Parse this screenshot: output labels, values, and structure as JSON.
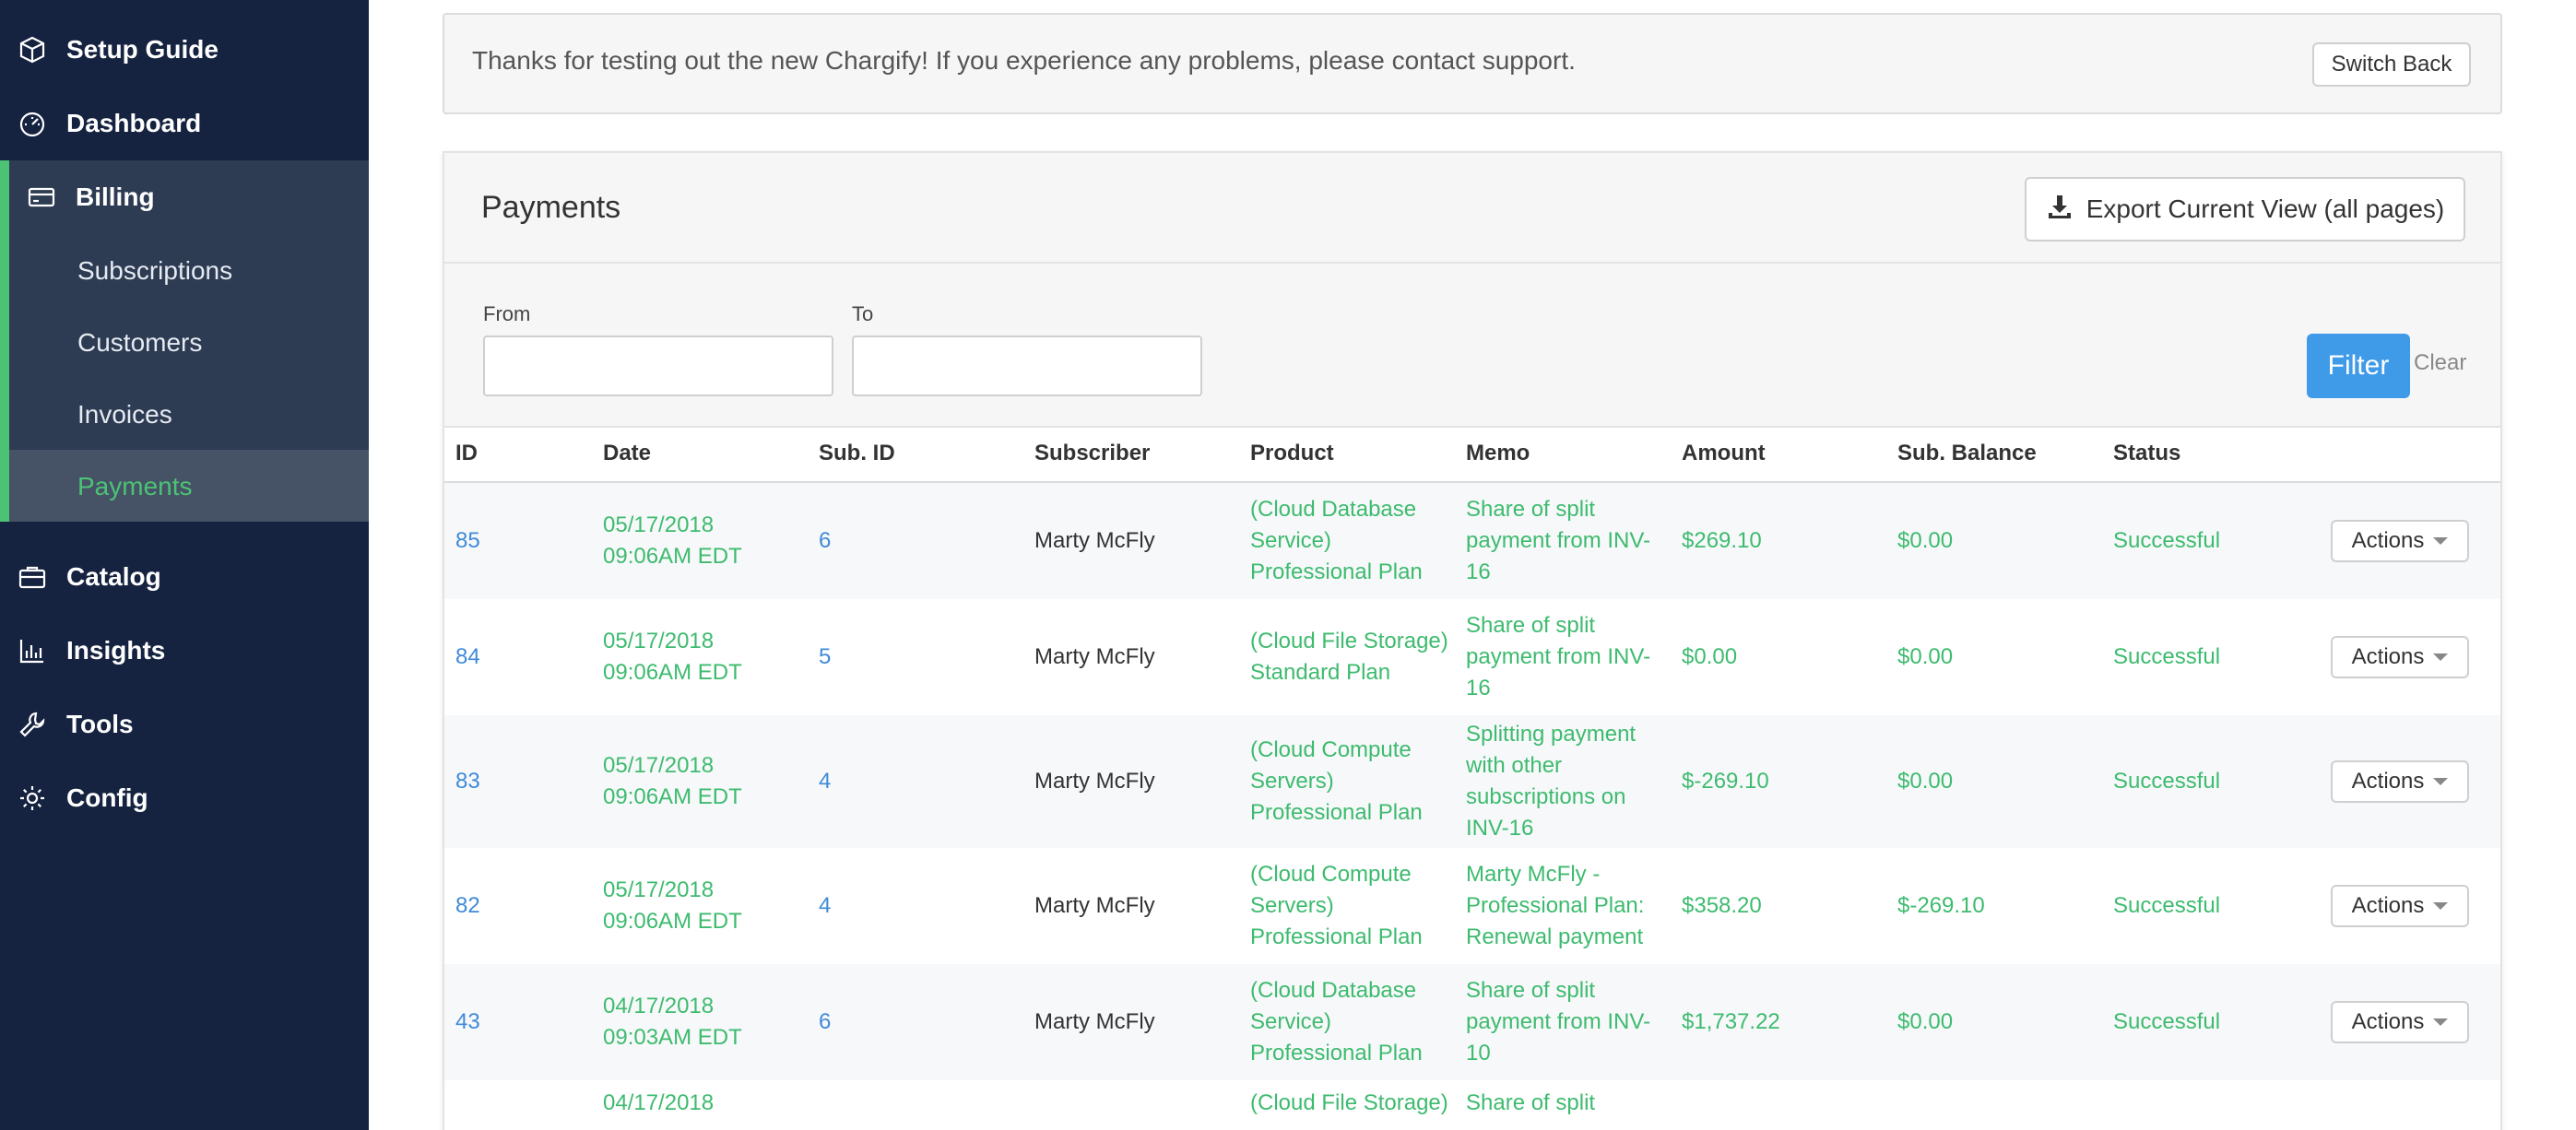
{
  "sidebar": {
    "items": [
      {
        "label": "Setup Guide",
        "icon": "cube-icon"
      },
      {
        "label": "Dashboard",
        "icon": "gauge-icon"
      },
      {
        "label": "Billing",
        "icon": "credit-card-icon"
      },
      {
        "label": "Catalog",
        "icon": "briefcase-icon"
      },
      {
        "label": "Insights",
        "icon": "bar-chart-icon"
      },
      {
        "label": "Tools",
        "icon": "wrench-icon"
      },
      {
        "label": "Config",
        "icon": "gear-icon"
      }
    ],
    "billing_sub": [
      "Subscriptions",
      "Customers",
      "Invoices",
      "Payments"
    ],
    "active_sub": "Payments"
  },
  "notice": {
    "text": "Thanks for testing out the new Chargify! If you experience any problems, please contact support.",
    "button": "Switch Back"
  },
  "panel": {
    "title": "Payments",
    "export_label": "Export Current View (all pages)"
  },
  "filter": {
    "from_label": "From",
    "to_label": "To",
    "from_value": "",
    "to_value": "",
    "filter_label": "Filter",
    "clear_label": "Clear"
  },
  "table": {
    "headers": [
      "ID",
      "Date",
      "Sub. ID",
      "Subscriber",
      "Product",
      "Memo",
      "Amount",
      "Sub. Balance",
      "Status"
    ],
    "rows": [
      {
        "id": "85",
        "date": "05/17/2018\n09:06AM EDT",
        "sub_id": "6",
        "subscriber": "Marty McFly",
        "product": "(Cloud Database\nService)\nProfessional Plan",
        "memo": "Share of split\npayment from INV-\n16",
        "amount": "$269.10",
        "balance": "$0.00",
        "status": "Successful",
        "action": "Actions"
      },
      {
        "id": "84",
        "date": "05/17/2018\n09:06AM EDT",
        "sub_id": "5",
        "subscriber": "Marty McFly",
        "product": "(Cloud File Storage)\nStandard Plan",
        "memo": "Share of split\npayment from INV-\n16",
        "amount": "$0.00",
        "balance": "$0.00",
        "status": "Successful",
        "action": "Actions"
      },
      {
        "id": "83",
        "date": "05/17/2018\n09:06AM EDT",
        "sub_id": "4",
        "subscriber": "Marty McFly",
        "product": "(Cloud Compute\nServers)\nProfessional Plan",
        "memo": "Splitting payment\nwith other\nsubscriptions on\nINV-16",
        "amount": "$-269.10",
        "balance": "$0.00",
        "status": "Successful",
        "action": "Actions"
      },
      {
        "id": "82",
        "date": "05/17/2018\n09:06AM EDT",
        "sub_id": "4",
        "subscriber": "Marty McFly",
        "product": "(Cloud Compute\nServers)\nProfessional Plan",
        "memo": "Marty McFly -\nProfessional Plan:\nRenewal payment",
        "amount": "$358.20",
        "balance": "$-269.10",
        "status": "Successful",
        "action": "Actions"
      },
      {
        "id": "43",
        "date": "04/17/2018\n09:03AM EDT",
        "sub_id": "6",
        "subscriber": "Marty McFly",
        "product": "(Cloud Database\nService)\nProfessional Plan",
        "memo": "Share of split\npayment from INV-\n10",
        "amount": "$1,737.22",
        "balance": "$0.00",
        "status": "Successful",
        "action": "Actions"
      },
      {
        "id": "",
        "date": "04/17/2018",
        "sub_id": "",
        "subscriber": "",
        "product": "(Cloud File Storage)",
        "memo": "Share of split",
        "amount": "",
        "balance": "",
        "status": "",
        "action": ""
      }
    ]
  },
  "colors": {
    "sidebar_bg": "#152340",
    "billing_bg": "#2d3b53",
    "accent_green": "#4cc275",
    "link_blue": "#3f8ad8",
    "text_green": "#3dbb6e",
    "filter_button": "#3f9ae8"
  }
}
